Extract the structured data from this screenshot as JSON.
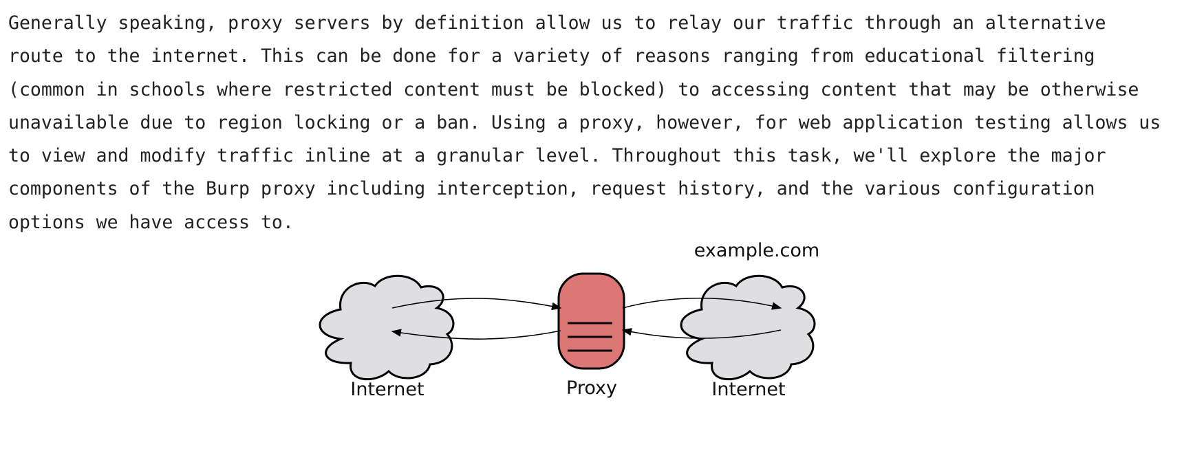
{
  "paragraph": {
    "lines": [
      "Generally speaking, proxy servers by definition allow us to relay our traffic through an alternative",
      "route to the internet. This can be done for a variety of reasons ranging from educational filtering",
      "(common in schools where restricted content must be blocked) to accessing content that may be otherwise",
      "unavailable due to region locking or a ban. Using a proxy, however, for web application testing allows us",
      "to view and modify traffic inline at a granular level. Throughout this task, we'll explore the major",
      "components of the Burp proxy including interception, request history, and the various configuration",
      "options we have access to."
    ]
  },
  "diagram": {
    "left_cloud_label": "Internet",
    "proxy_label": "Proxy",
    "right_cloud_label": "Internet",
    "right_cloud_top_label": "example.com",
    "colors": {
      "cloud_fill": "#dfdfe1",
      "proxy_fill": "#dd7775",
      "stroke": "#000000"
    }
  }
}
